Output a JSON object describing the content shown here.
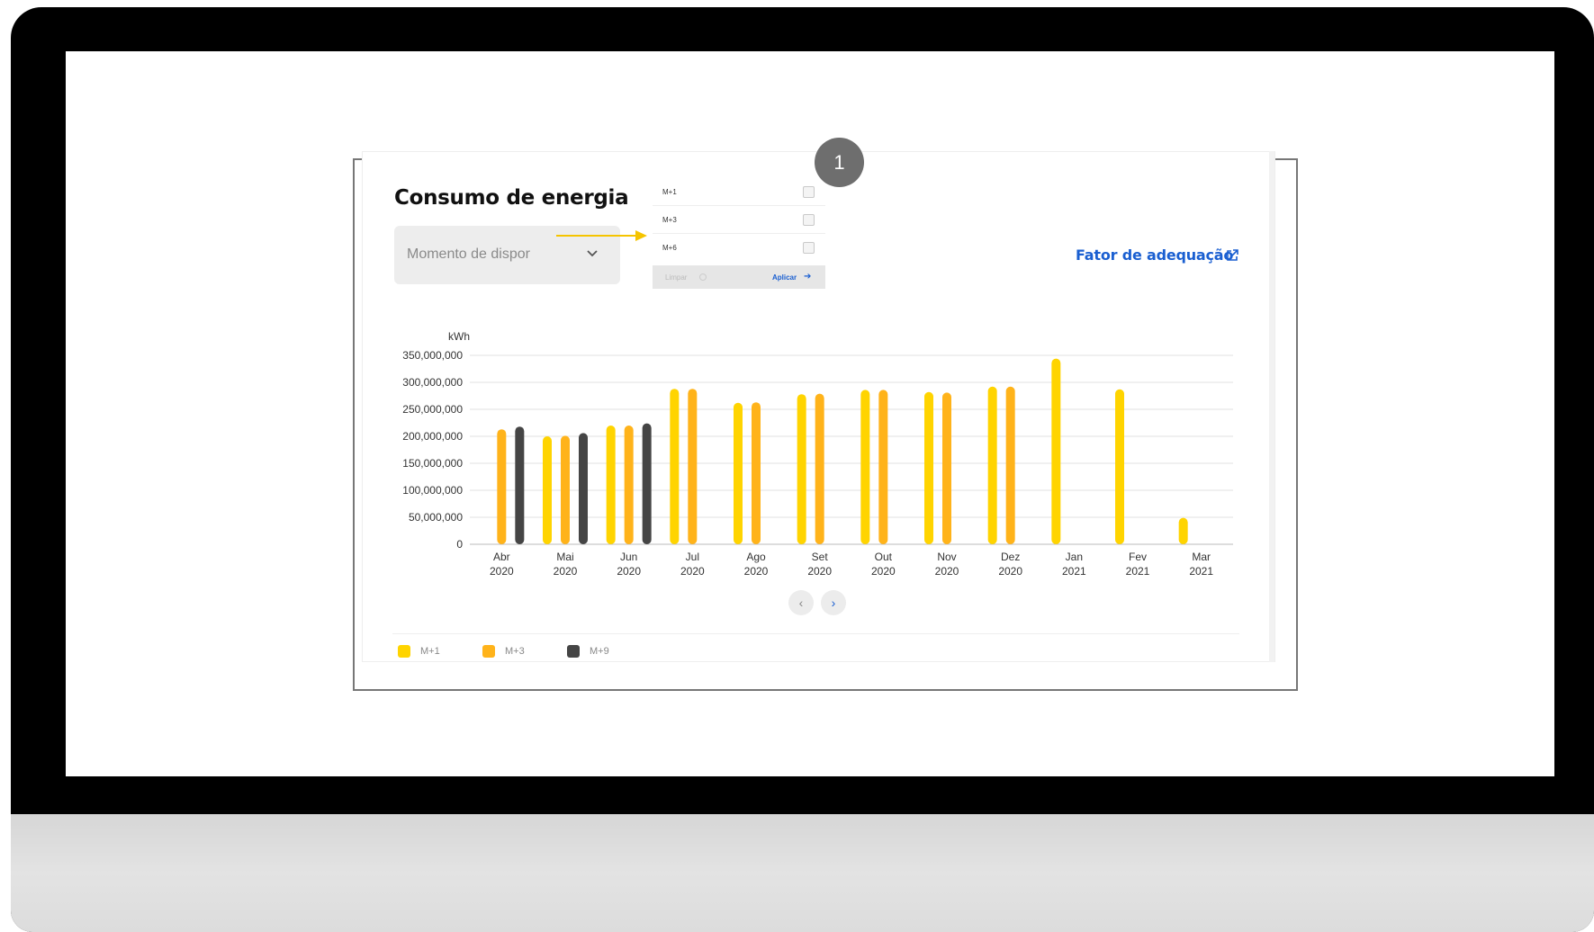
{
  "card": {
    "title": "Consumo de energia",
    "select_value": "Momento de dispor",
    "link_label": "Fator de adequação",
    "badge": "1"
  },
  "dropdown": {
    "options": [
      "M+1",
      "M+3",
      "M+6"
    ],
    "clear_label": "Limpar",
    "apply_label": "Aplicar"
  },
  "icons": {
    "select": "chevron-down-icon",
    "link": "external-link-icon",
    "prev": "chevron-left-icon",
    "next": "chevron-right-icon",
    "apply": "arrow-right-icon"
  },
  "colors": {
    "m1": "#FFD400",
    "m3": "#FFB31A",
    "m9": "#454545",
    "link": "#1A5FD1",
    "annotation": "#F5C400"
  },
  "chart_data": {
    "type": "bar",
    "ylabel": "kWh",
    "ylim": [
      0,
      350000000
    ],
    "yticks": [
      "350,000,000",
      "300,000,000",
      "250,000,000",
      "200,000,000",
      "150,000,000",
      "100,000,000",
      "50,000,000",
      "0"
    ],
    "yvalues": [
      350000000,
      300000000,
      250000000,
      200000000,
      150000000,
      100000000,
      50000000,
      0
    ],
    "categories": [
      {
        "month": "Abr",
        "year": "2020"
      },
      {
        "month": "Mai",
        "year": "2020"
      },
      {
        "month": "Jun",
        "year": "2020"
      },
      {
        "month": "Jul",
        "year": "2020"
      },
      {
        "month": "Ago",
        "year": "2020"
      },
      {
        "month": "Set",
        "year": "2020"
      },
      {
        "month": "Out",
        "year": "2020"
      },
      {
        "month": "Nov",
        "year": "2020"
      },
      {
        "month": "Dez",
        "year": "2020"
      },
      {
        "month": "Jan",
        "year": "2021"
      },
      {
        "month": "Fev",
        "year": "2021"
      },
      {
        "month": "Mar",
        "year": "2021"
      }
    ],
    "series": [
      {
        "name": "M+1",
        "color": "#FFD400",
        "values": [
          null,
          200000000,
          220000000,
          288000000,
          262000000,
          278000000,
          286000000,
          282000000,
          292000000,
          344000000,
          287000000,
          49000000
        ]
      },
      {
        "name": "M+3",
        "color": "#FFB31A",
        "values": [
          213000000,
          201000000,
          220000000,
          288000000,
          263000000,
          279000000,
          286000000,
          281000000,
          292000000,
          null,
          null,
          null
        ]
      },
      {
        "name": "M+9",
        "color": "#454545",
        "values": [
          218000000,
          206000000,
          224000000,
          null,
          null,
          null,
          null,
          null,
          null,
          null,
          null,
          null
        ]
      }
    ],
    "legend": [
      "M+1",
      "M+3",
      "M+9"
    ],
    "grid": true
  }
}
